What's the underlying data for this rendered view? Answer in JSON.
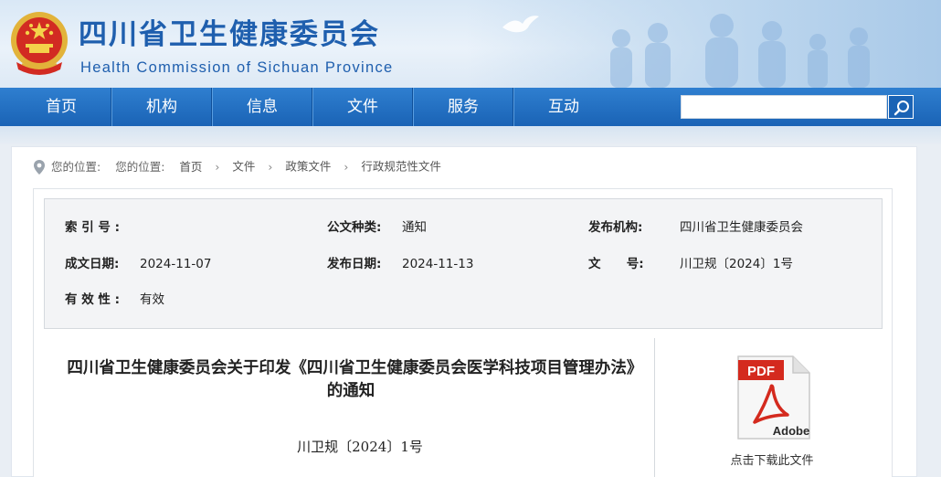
{
  "header": {
    "title_cn": "四川省卫生健康委员会",
    "title_en": "Health Commission of Sichuan Province"
  },
  "nav": {
    "items": [
      {
        "label": "首页"
      },
      {
        "label": "机构"
      },
      {
        "label": "信息"
      },
      {
        "label": "文件"
      },
      {
        "label": "服务"
      },
      {
        "label": "互动"
      }
    ],
    "search": {
      "value": "",
      "placeholder": ""
    }
  },
  "breadcrumb": {
    "prefix1": "您的位置:",
    "prefix2": "您的位置:",
    "items": [
      "首页",
      "文件",
      "政策文件",
      "行政规范性文件"
    ]
  },
  "meta": {
    "index_label": "索 引 号 :",
    "index_value": "",
    "doc_type_label": "公文种类:",
    "doc_type_value": "通知",
    "publisher_label": "发布机构:",
    "publisher_value": "四川省卫生健康委员会",
    "created_label": "成文日期:",
    "created_value": "2024-11-07",
    "published_label": "发布日期:",
    "published_value": "2024-11-13",
    "docno_label": "文      号:",
    "docno_value": "川卫规〔2024〕1号",
    "validity_label": "有 效 性 :",
    "validity_value": "有效"
  },
  "document": {
    "title": "四川省卫生健康委员会关于印发《四川省卫生健康委员会医学科技项目管理办法》的通知",
    "number": "川卫规〔2024〕1号"
  },
  "download": {
    "badge": "PDF",
    "brand": "Adobe",
    "caption": "点击下载此文件"
  },
  "colors": {
    "brand_blue": "#1f5fae",
    "nav_blue": "#1a63b5",
    "pdf_red": "#d42a1e"
  }
}
